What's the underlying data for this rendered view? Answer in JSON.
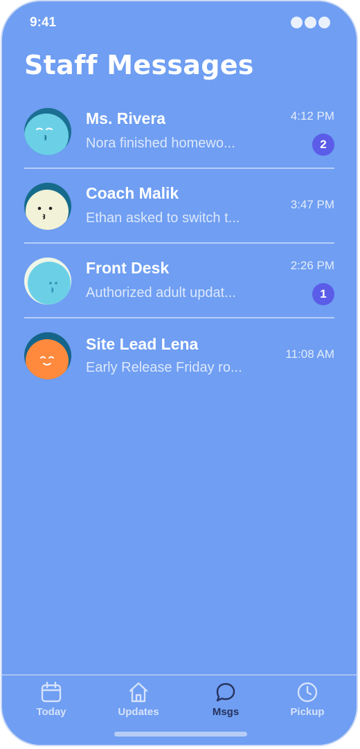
{
  "status_bar": {
    "time": "9:41"
  },
  "page_title": "Staff Messages",
  "messages": [
    {
      "name": "Ms. Rivera",
      "preview": "Nora finished homewo...",
      "time": "4:12 PM",
      "badge": "2",
      "avatar": "ms-rivera-avatar"
    },
    {
      "name": "Coach Malik",
      "preview": "Ethan asked to switch t...",
      "time": "3:47 PM",
      "badge": "",
      "avatar": "coach-malik-avatar"
    },
    {
      "name": "Front Desk",
      "preview": "Authorized adult updat...",
      "time": "2:26 PM",
      "badge": "1",
      "avatar": "front-desk-avatar"
    },
    {
      "name": "Site Lead Lena",
      "preview": "Early Release Friday ro...",
      "time": "11:08 AM",
      "badge": "",
      "avatar": "site-lead-lena-avatar"
    }
  ],
  "tabs": [
    {
      "label": "Today",
      "icon": "calendar-icon",
      "active": false
    },
    {
      "label": "Updates",
      "icon": "home-icon",
      "active": false
    },
    {
      "label": "Msgs",
      "icon": "chat-bubble-icon",
      "active": true
    },
    {
      "label": "Pickup",
      "icon": "clock-icon",
      "active": false
    }
  ],
  "colors": {
    "background": "#6f9ef2",
    "badge": "#5b5ce8",
    "active_tab": "#26325e",
    "inactive_tab": "#d6e3fb"
  }
}
